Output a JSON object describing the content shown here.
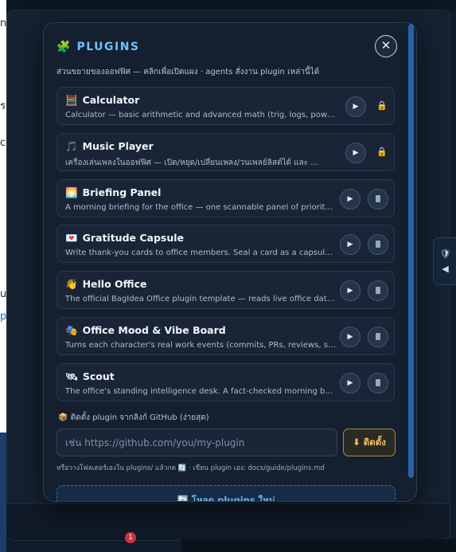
{
  "modal": {
    "title": "PLUGINS",
    "subtitle": "ส่วนขยายของออฟฟิศ — คลิกเพื่อเปิดแผง · agents สั่งงาน plugin เหล่านี้ได้",
    "close_label": "✕"
  },
  "plugins": [
    {
      "emoji": "🧮",
      "name": "Calculator",
      "description": "Calculator — basic arithmetic and advanced math (trig, logs, powers,...",
      "locked": true
    },
    {
      "emoji": "🎵",
      "name": "Music Player",
      "description": "เครื่องเล่นเพลงในออฟฟิศ — เปิด/หยุด/เปลี่ยนเพลง/วนเพลย์ลิสต์ได้ และ ...",
      "locked": true
    },
    {
      "emoji": "🌅",
      "name": "Briefing Panel",
      "description": "A morning briefing for the office — one scannable panel of priority...",
      "locked": false
    },
    {
      "emoji": "💌",
      "name": "Gratitude Capsule",
      "description": "Write thank-you cards to office members. Seal a card as a capsule t...",
      "locked": false
    },
    {
      "emoji": "👋",
      "name": "Hello Office",
      "description": "The official BagIdea Office plugin template — reads live office data,...",
      "locked": false
    },
    {
      "emoji": "🎭",
      "name": "Office Mood & Vibe Board",
      "description": "Turns each character's real work events (commits, PRs, reviews, sess...",
      "locked": false
    },
    {
      "emoji": "🛰",
      "name": "Scout",
      "description": "The office's standing intelligence desk. A fact-checked morning bri...",
      "locked": false
    }
  ],
  "install": {
    "label": "📦 ติดตั้ง plugin จากลิงก์ GitHub (ง่ายสุด)",
    "input_placeholder": "เช่น https://github.com/you/my-plugin",
    "button_label": "⬇ ติดตั้ง",
    "hint": "หรือวางโฟลเดอร์เองใน plugins/ แล้วกด 🔄 · เขียน plugin เอง: docs/guide/plugins.md"
  },
  "reload": {
    "label": "🔄 โหลด plugins ใหม่"
  },
  "background": {
    "left_fragments": [
      "n",
      "ร",
      "ce",
      "u",
      "p"
    ],
    "notification_count": "1"
  },
  "colors": {
    "accent": "#6cc3ff",
    "install_accent": "#f0c165",
    "lock": "#c89a3c"
  }
}
